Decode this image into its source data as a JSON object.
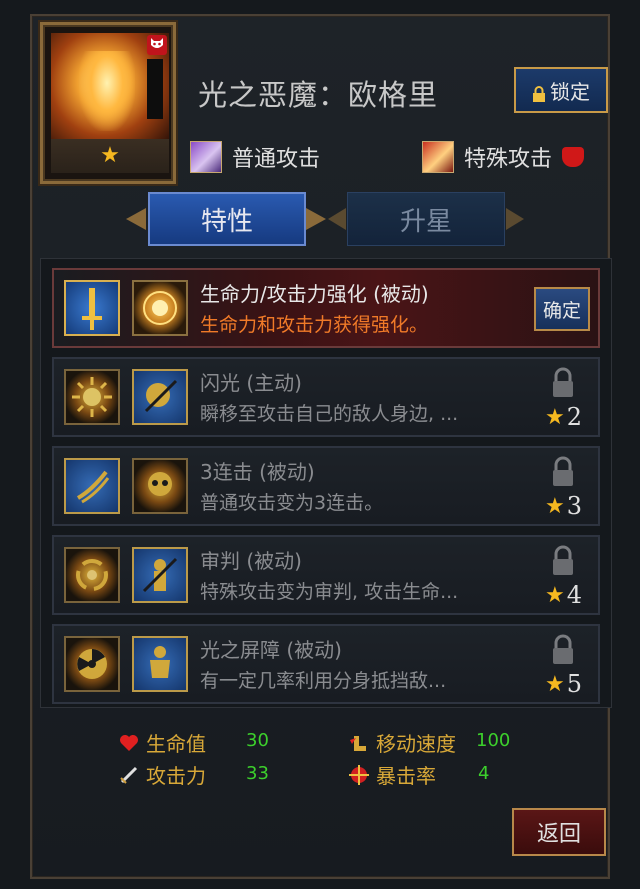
{
  "hero": {
    "name": "光之恶魔：欧格里",
    "stars": "★",
    "lock_label": "锁定"
  },
  "attacks": {
    "normal_label": "普通攻击",
    "special_label": "特殊攻击"
  },
  "tabs": [
    {
      "label": "特性",
      "active": true
    },
    {
      "label": "升星",
      "active": false
    }
  ],
  "traits": [
    {
      "title": "生命力/攻击力强化 (被动)",
      "desc": "生命力和攻击力获得强化。",
      "selected": true,
      "confirm_label": "确定"
    },
    {
      "title": "闪光 (主动)",
      "desc": "瞬移至攻击自己的敌人身边, ...",
      "locked": true,
      "star_req": "2"
    },
    {
      "title": "3连击 (被动)",
      "desc": "普通攻击变为3连击。",
      "locked": true,
      "star_req": "3"
    },
    {
      "title": "审判 (被动)",
      "desc": "特殊攻击变为审判, 攻击生命...",
      "locked": true,
      "star_req": "4"
    },
    {
      "title": "光之屏障 (被动)",
      "desc": "有一定几率利用分身抵挡敌...",
      "locked": true,
      "star_req": "5"
    }
  ],
  "stats": {
    "hp_label": "生命值",
    "hp_value": "30",
    "atk_label": "攻击力",
    "atk_value": "33",
    "speed_label": "移动速度",
    "speed_value": "100",
    "crit_label": "暴击率",
    "crit_value": "4"
  },
  "back_label": "返回",
  "colors": {
    "accent_gold": "#c89a48",
    "blue_button": "#2a5ab0",
    "stat_value_green": "#3cd02c",
    "stat_label_gold": "#d8a838",
    "selected_desc_orange": "#f07a28",
    "star_yellow": "#f5b820"
  }
}
